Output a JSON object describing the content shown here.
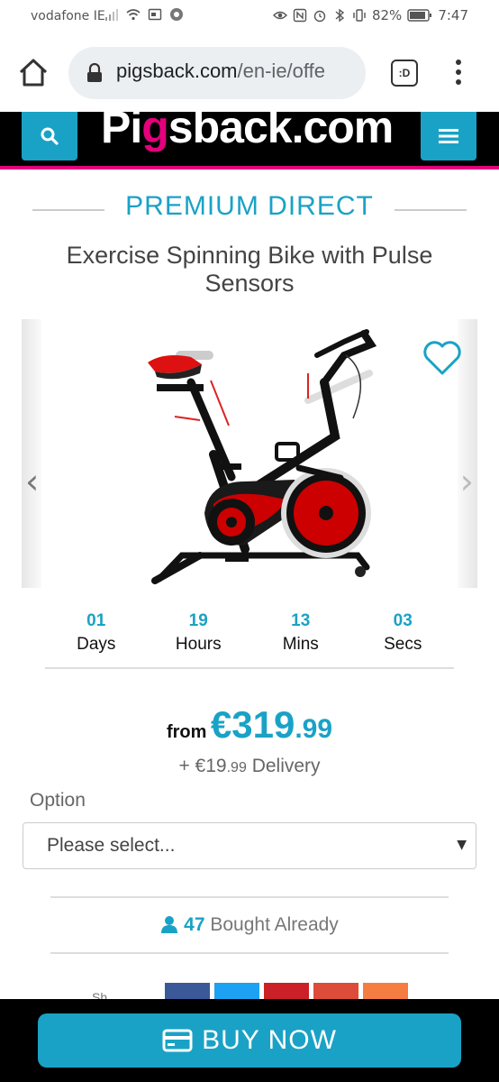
{
  "status_bar": {
    "carrier": "vodafone IE",
    "battery": "82%",
    "time": "7:47"
  },
  "browser": {
    "url_host": "pigsback.com",
    "url_path": "/en-ie/offe",
    "tabs_label": ":D"
  },
  "site": {
    "logo_text_a": "Pi",
    "logo_text_g": "g",
    "logo_text_b": "sback.com"
  },
  "product": {
    "brand": "PREMIUM DIRECT",
    "title": "Exercise Spinning Bike with Pulse Sensors"
  },
  "countdown": [
    {
      "value": "01",
      "label": "Days"
    },
    {
      "value": "19",
      "label": "Hours"
    },
    {
      "value": "13",
      "label": "Mins"
    },
    {
      "value": "03",
      "label": "Secs"
    }
  ],
  "pricing": {
    "from_label": "from",
    "price_main": "€319",
    "price_cents": ".99",
    "delivery_prefix": "+ €19",
    "delivery_cents": ".99",
    "delivery_label": "Delivery"
  },
  "option": {
    "label": "Option",
    "selected": "Please select..."
  },
  "bought": {
    "count": "47",
    "label": "Bought Already"
  },
  "share": {
    "label": "Sh"
  },
  "cta": {
    "buy_label": "BUY NOW"
  },
  "colors": {
    "accent": "#1aa2c6",
    "brand_pink": "#e4007c"
  }
}
